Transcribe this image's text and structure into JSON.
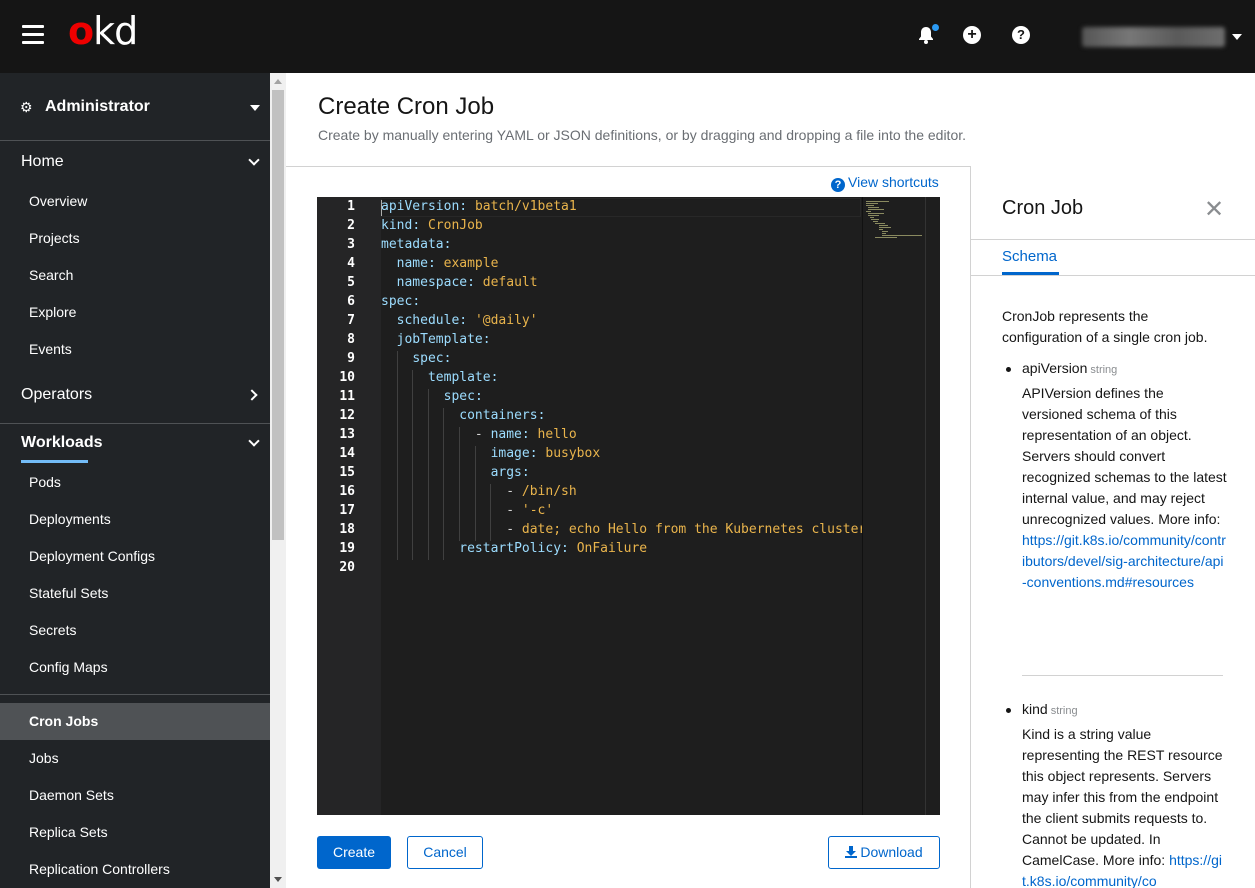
{
  "masthead": {
    "logo_o": "o",
    "logo_kd": "kd",
    "plus_glyph": "+",
    "help_glyph": "?"
  },
  "sidebar": {
    "perspective": "Administrator",
    "sections": {
      "home": "Home",
      "operators": "Operators",
      "workloads": "Workloads"
    },
    "home_items": [
      "Overview",
      "Projects",
      "Search",
      "Explore",
      "Events"
    ],
    "workload_items": [
      "Pods",
      "Deployments",
      "Deployment Configs",
      "Stateful Sets",
      "Secrets",
      "Config Maps",
      "Cron Jobs",
      "Jobs",
      "Daemon Sets",
      "Replica Sets",
      "Replication Controllers"
    ],
    "active_item": "Cron Jobs"
  },
  "main": {
    "title": "Create Cron Job",
    "description": "Create by manually entering YAML or JSON definitions, or by dragging and dropping a file into the editor.",
    "view_shortcuts": "View shortcuts",
    "create_label": "Create",
    "cancel_label": "Cancel",
    "download_label": "Download"
  },
  "editor": {
    "line_numbers": [
      "1",
      "2",
      "3",
      "4",
      "5",
      "6",
      "7",
      "8",
      "9",
      "10",
      "11",
      "12",
      "13",
      "14",
      "15",
      "16",
      "17",
      "18",
      "19",
      "20"
    ],
    "lines": [
      {
        "indent": "",
        "key": "apiVersion",
        "sep": ": ",
        "val": "batch/v1beta1"
      },
      {
        "indent": "",
        "key": "kind",
        "sep": ": ",
        "val": "CronJob"
      },
      {
        "indent": "",
        "key": "metadata",
        "sep": ":",
        "val": ""
      },
      {
        "indent": "  ",
        "key": "name",
        "sep": ": ",
        "val": "example"
      },
      {
        "indent": "  ",
        "key": "namespace",
        "sep": ": ",
        "val": "default"
      },
      {
        "indent": "",
        "key": "spec",
        "sep": ":",
        "val": ""
      },
      {
        "indent": "  ",
        "key": "schedule",
        "sep": ": ",
        "val": "'@daily'"
      },
      {
        "indent": "  ",
        "key": "jobTemplate",
        "sep": ":",
        "val": ""
      },
      {
        "indent": "    ",
        "key": "spec",
        "sep": ":",
        "val": ""
      },
      {
        "indent": "      ",
        "key": "template",
        "sep": ":",
        "val": ""
      },
      {
        "indent": "        ",
        "key": "spec",
        "sep": ":",
        "val": ""
      },
      {
        "indent": "          ",
        "key": "containers",
        "sep": ":",
        "val": ""
      },
      {
        "indent": "            - ",
        "key": "name",
        "sep": ": ",
        "val": "hello"
      },
      {
        "indent": "              ",
        "key": "image",
        "sep": ": ",
        "val": "busybox"
      },
      {
        "indent": "              ",
        "key": "args",
        "sep": ":",
        "val": ""
      },
      {
        "indent": "                - ",
        "key": "",
        "sep": "",
        "val": "/bin/sh"
      },
      {
        "indent": "                - ",
        "key": "",
        "sep": "",
        "val": "'-c'"
      },
      {
        "indent": "                - ",
        "key": "",
        "sep": "",
        "val": "date; echo Hello from the Kubernetes cluster"
      },
      {
        "indent": "          ",
        "key": "restartPolicy",
        "sep": ": ",
        "val": "OnFailure"
      },
      {
        "indent": "",
        "key": "",
        "sep": "",
        "val": ""
      }
    ]
  },
  "schema_panel": {
    "title": "Cron Job",
    "close_glyph": "✕",
    "tab": "Schema",
    "description": "CronJob represents the configuration of a single cron job.",
    "fields": [
      {
        "name": "apiVersion",
        "type": "string",
        "desc": "APIVersion defines the versioned schema of this representation of an object. Servers should convert recognized schemas to the latest internal value, and may reject unrecognized values. More info:",
        "link": "https://git.k8s.io/community/contributors/devel/sig-architecture/api-conventions.md#resources"
      },
      {
        "name": "kind",
        "type": "string",
        "desc": "Kind is a string value representing the REST resource this object represents. Servers may infer this from the endpoint the client submits requests to. Cannot be updated. In CamelCase. More info:",
        "link": "https://git.k8s.io/community/co"
      }
    ]
  },
  "colors": {
    "masthead": "#151515",
    "sidebar": "#212427",
    "accent": "#0066cc",
    "logo_red": "#ee0000",
    "editor_bg": "#1e1e1e"
  }
}
